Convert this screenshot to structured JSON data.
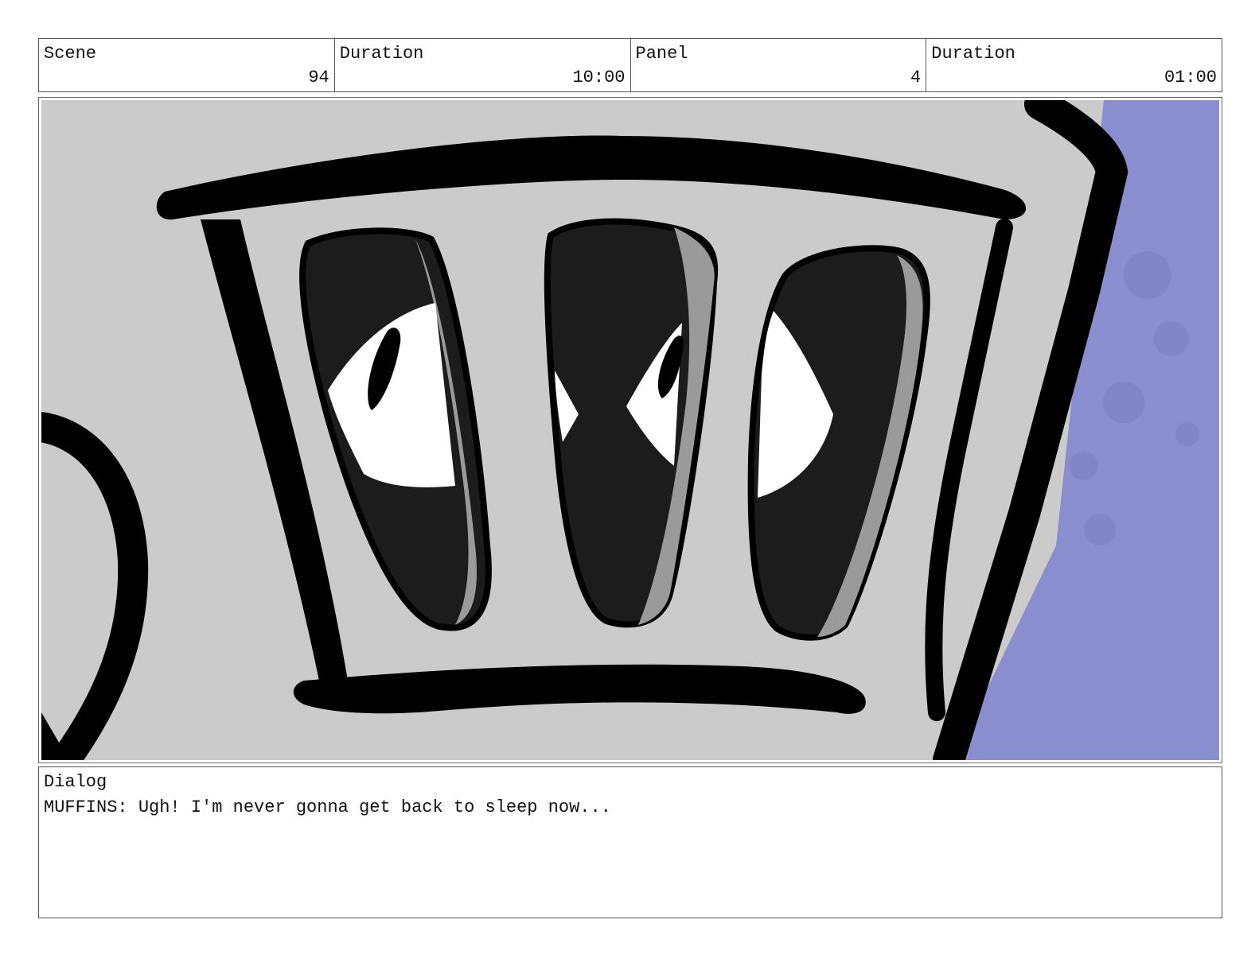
{
  "header": {
    "scene_label": "Scene",
    "scene_value": "94",
    "scene_duration_label": "Duration",
    "scene_duration_value": "10:00",
    "panel_label": "Panel",
    "panel_value": "4",
    "panel_duration_label": "Duration",
    "panel_duration_value": "01:00"
  },
  "panel": {
    "background_color": "#cbcbcb",
    "wall_color": "#8a8ecf",
    "outline_color": "#000000",
    "slot_color": "#1c1c1c",
    "slot_highlight_color": "#9a9a9a",
    "eye_white_color": "#ffffff"
  },
  "dialog": {
    "label": "Dialog",
    "text": "MUFFINS: Ugh! I'm never gonna get back to sleep now..."
  }
}
